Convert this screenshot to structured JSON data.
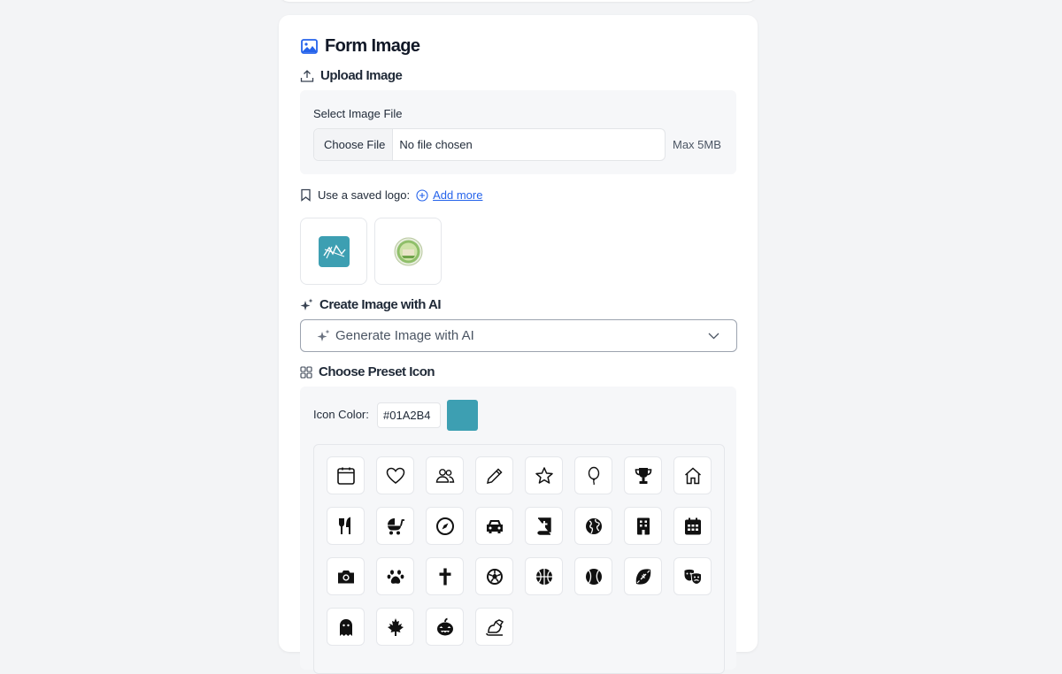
{
  "form_image": {
    "title": "Form Image",
    "title_icon": "image-icon"
  },
  "upload": {
    "heading": "Upload Image",
    "heading_icon": "upload-icon",
    "select_label": "Select Image File",
    "choose_button": "Choose File",
    "file_status": "No file chosen",
    "max_size": "Max 5MB"
  },
  "saved_logo": {
    "label": "Use a saved logo:",
    "label_icon": "bookmark-icon",
    "add_more": "Add more",
    "add_more_icon": "plus-circle-icon",
    "logos": [
      "teal-square-logo",
      "round-green-seal-logo"
    ]
  },
  "ai": {
    "heading": "Create Image with AI",
    "heading_icon": "sparkles-icon",
    "select_text": "Generate Image with AI",
    "select_icon": "sparkles-icon",
    "dropdown_icon": "chevron-down-icon"
  },
  "preset": {
    "heading": "Choose Preset Icon",
    "heading_icon": "grid-icon",
    "color_label": "Icon Color:",
    "color_value": "#01A2B4",
    "swatch_color": "#3d9fb2",
    "icons": [
      [
        "calendar-icon",
        "heart-icon",
        "users-icon",
        "pencil-icon",
        "star-icon",
        "balloon-icon",
        "trophy-icon",
        "home-icon"
      ],
      [
        "utensils-icon",
        "baby-carriage-icon",
        "compass-icon",
        "car-icon",
        "bible-icon",
        "globe-icon",
        "building-icon",
        "calendar-solid-icon"
      ],
      [
        "camera-icon",
        "paw-icon",
        "cross-icon",
        "soccer-ball-icon",
        "basketball-icon",
        "baseball-icon",
        "football-icon",
        "theater-masks-icon"
      ],
      [
        "ghost-icon",
        "maple-leaf-icon",
        "pumpkin-icon",
        "sleigh-icon"
      ]
    ]
  },
  "colors": {
    "accent_link": "#2563eb",
    "logo_teal": "#3d9fb2"
  }
}
